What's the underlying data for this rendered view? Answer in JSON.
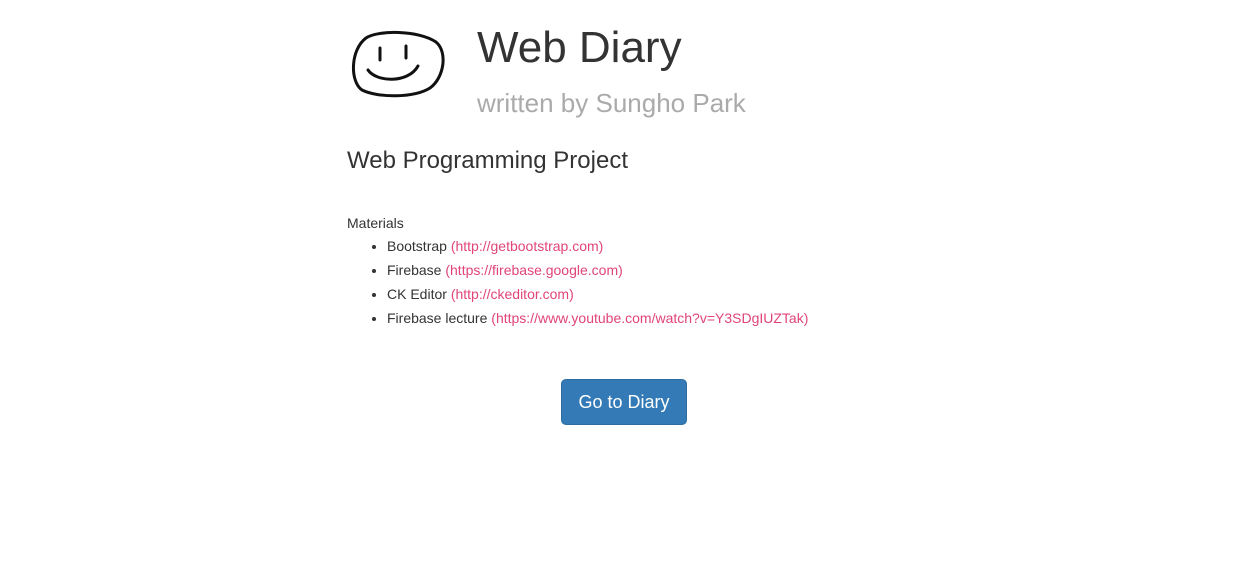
{
  "header": {
    "title": "Web Diary",
    "subtitle": "written by Sungho Park",
    "logo_icon": "smiley-face-icon"
  },
  "main": {
    "heading": "Web Programming Project",
    "materials_label": "Materials",
    "materials": [
      {
        "name": "Bootstrap",
        "link": "(http://getbootstrap.com)"
      },
      {
        "name": "Firebase",
        "link": "(https://firebase.google.com)"
      },
      {
        "name": "CK Editor",
        "link": "(http://ckeditor.com)"
      },
      {
        "name": "Firebase lecture",
        "link": "(https://www.youtube.com/watch?v=Y3SDgIUZTak)"
      }
    ],
    "go_button_label": "Go to Diary"
  },
  "colors": {
    "link": "#e0447a",
    "button": "#337ab7",
    "subtitle": "#aaaaaa"
  }
}
